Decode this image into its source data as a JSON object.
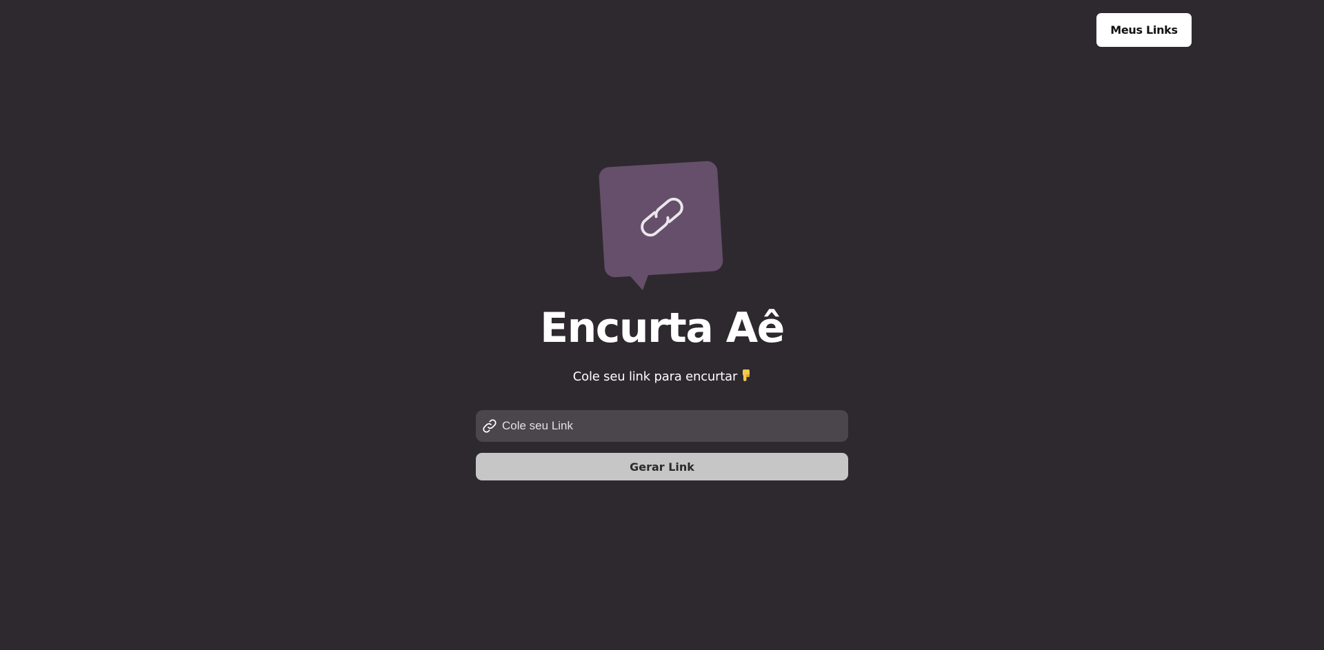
{
  "header": {
    "my_links_label": "Meus Links"
  },
  "hero": {
    "logo_icon": "chat-bubble-link-icon",
    "title": "Encurta Aê",
    "subtitle": "Cole seu link para encurtar",
    "subtitle_emoji": "👇"
  },
  "form": {
    "input_icon": "link-icon",
    "input_value": "",
    "input_placeholder": "Cole seu Link",
    "submit_label": "Gerar Link"
  },
  "colors": {
    "background": "#2e292f",
    "logo_bubble": "#654f6a",
    "input_background": "#4b464c",
    "button_background": "#c6c6c6",
    "header_button_background": "#ffffff"
  }
}
